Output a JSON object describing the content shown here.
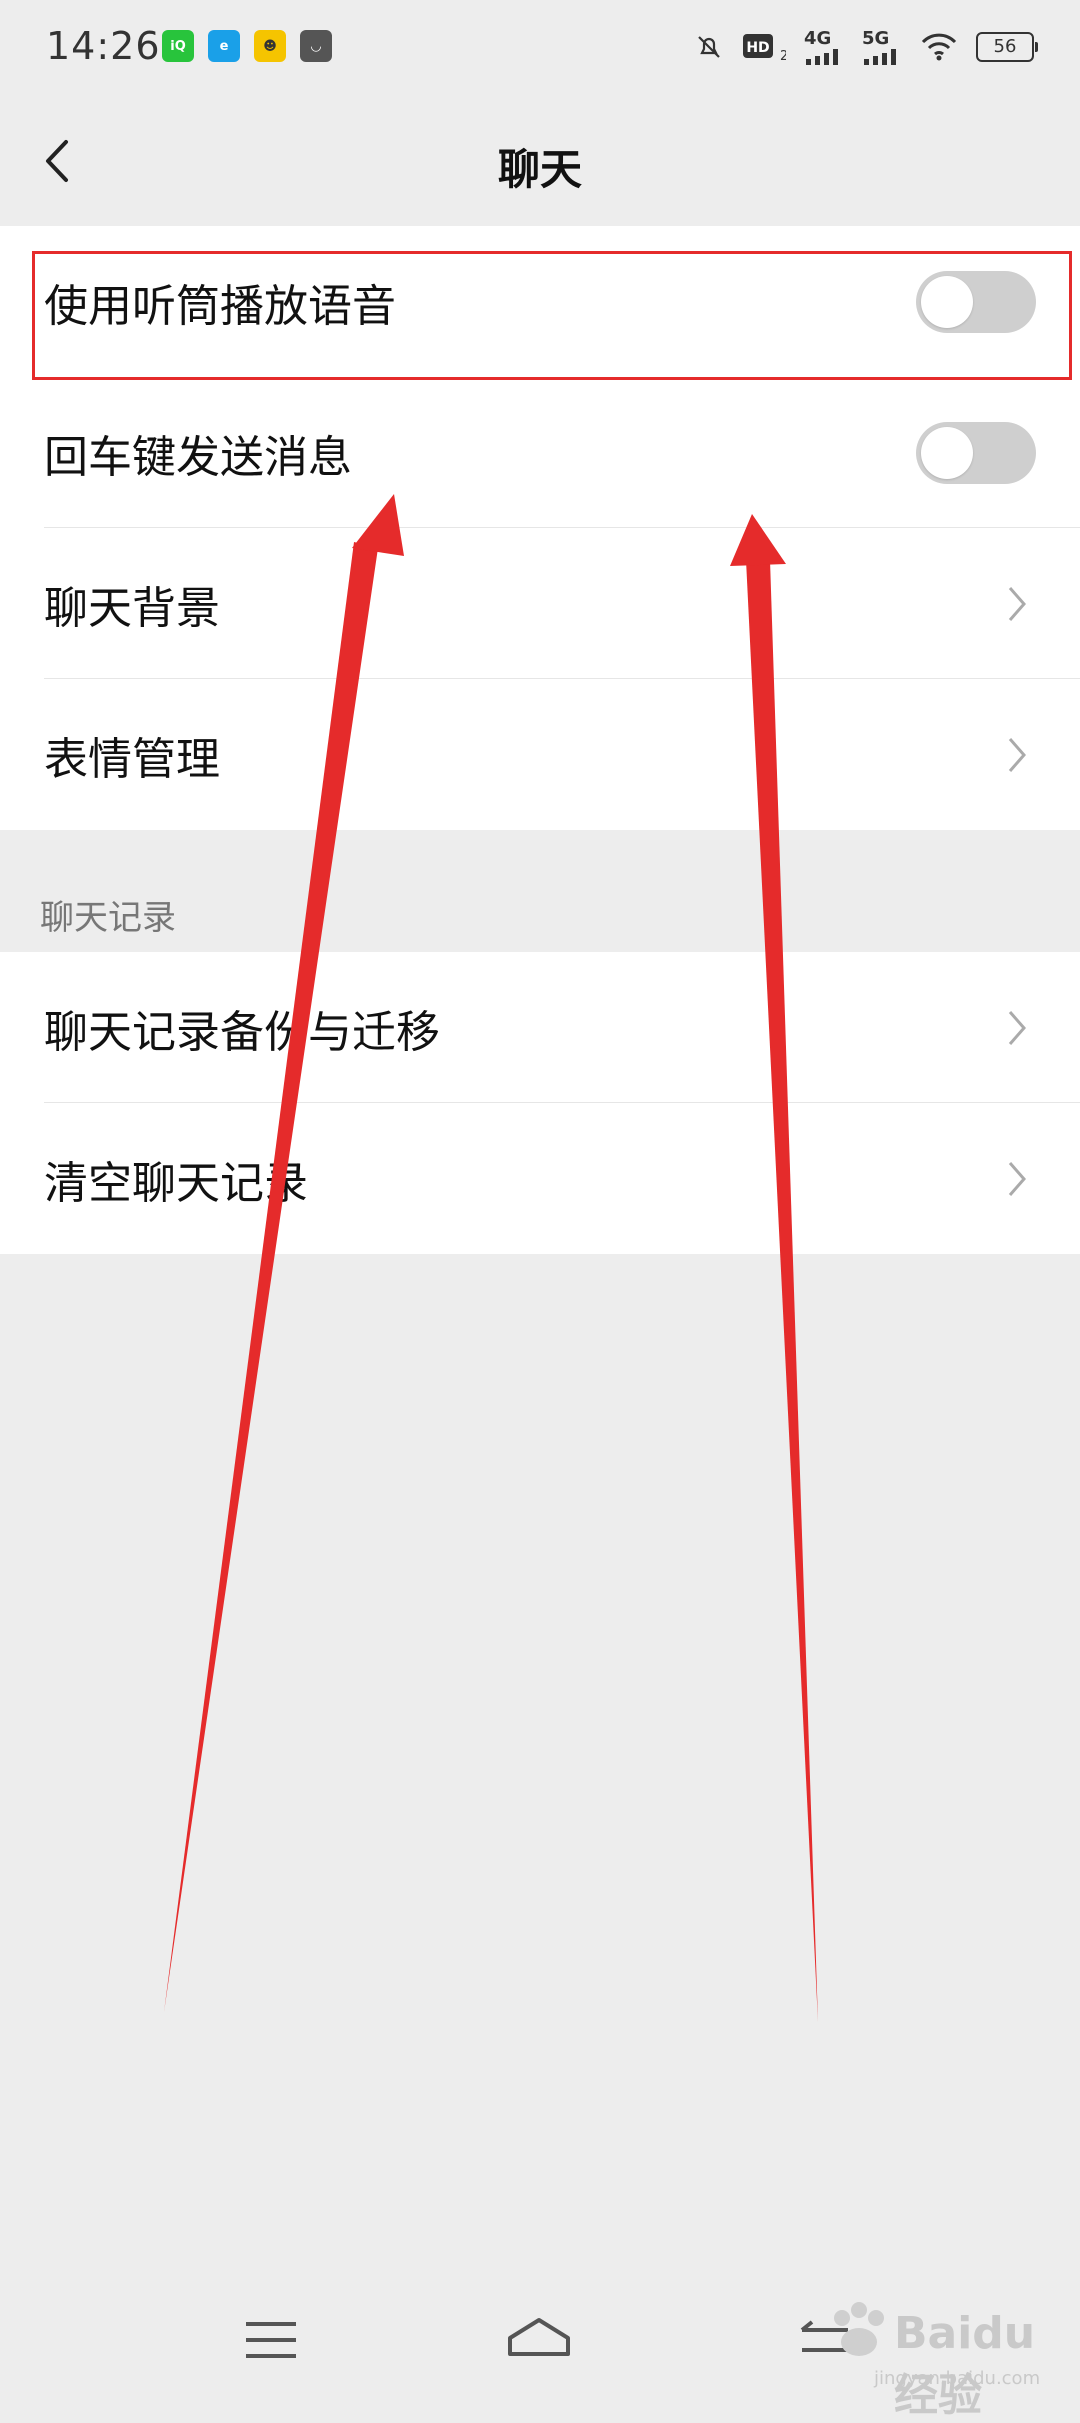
{
  "status": {
    "time": "14:26",
    "net1": "4G",
    "net2": "5G",
    "battery": "56"
  },
  "nav": {
    "title": "聊天"
  },
  "settings": {
    "items": [
      {
        "label": "使用听筒播放语音",
        "control": "toggle",
        "value": "off"
      },
      {
        "label": "回车键发送消息",
        "control": "toggle",
        "value": "off"
      },
      {
        "label": "聊天背景",
        "control": "chevron"
      },
      {
        "label": "表情管理",
        "control": "chevron"
      }
    ]
  },
  "history": {
    "section_title": "聊天记录",
    "items": [
      {
        "label": "聊天记录备份与迁移",
        "control": "chevron"
      },
      {
        "label": "清空聊天记录",
        "control": "chevron"
      }
    ]
  },
  "watermark": {
    "text": "Baidu经验",
    "url": "jingyan.baidu.com"
  },
  "colors": {
    "annotation": "#e52b2b",
    "toggle_off": "#cfcfcf",
    "background": "#ededed"
  }
}
